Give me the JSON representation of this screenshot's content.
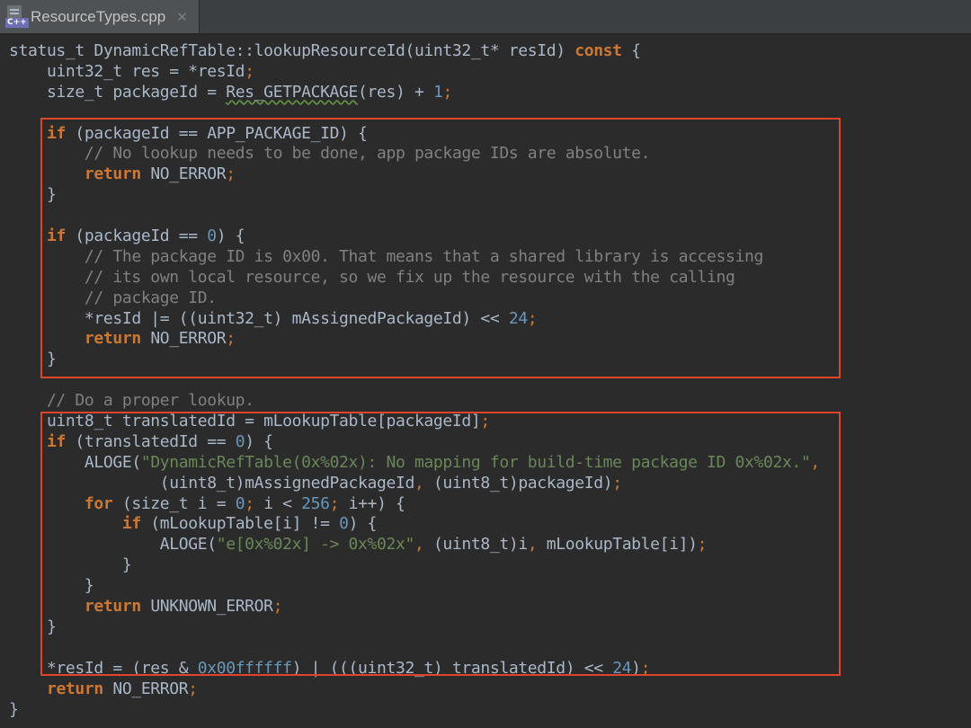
{
  "tab": {
    "title": "ResourceTypes.cpp",
    "icon_badge": "C++",
    "close_glyph": "✕"
  },
  "colors": {
    "keyword": "#cc7832",
    "number": "#6897bb",
    "string": "#6a8759",
    "comment": "#808080",
    "text": "#a9b7c6",
    "highlight_box": "#e0442d",
    "background": "#2b2b2b"
  },
  "code_lines": [
    [
      [
        "t",
        "status_t DynamicRefTable::lookupResourceId(uint32_t* resId) "
      ],
      [
        "kw",
        "const"
      ],
      [
        "t",
        " {"
      ]
    ],
    [
      [
        "t",
        "    uint32_t res = *resId"
      ],
      [
        "pun",
        ";"
      ]
    ],
    [
      [
        "t",
        "    size_t packageId = "
      ],
      [
        "mac",
        "Res_GETPACKAGE"
      ],
      [
        "t",
        "(res) + "
      ],
      [
        "num",
        "1"
      ],
      [
        "pun",
        ";"
      ]
    ],
    [
      [
        "t",
        ""
      ]
    ],
    [
      [
        "t",
        "    "
      ],
      [
        "kw",
        "if"
      ],
      [
        "t",
        " (packageId == APP_PACKAGE_ID) {"
      ]
    ],
    [
      [
        "cm",
        "        // No lookup needs to be done, app package IDs are absolute."
      ]
    ],
    [
      [
        "t",
        "        "
      ],
      [
        "kw",
        "return"
      ],
      [
        "t",
        " NO_ERROR"
      ],
      [
        "pun",
        ";"
      ]
    ],
    [
      [
        "t",
        "    }"
      ]
    ],
    [
      [
        "t",
        ""
      ]
    ],
    [
      [
        "t",
        "    "
      ],
      [
        "kw",
        "if"
      ],
      [
        "t",
        " (packageId == "
      ],
      [
        "num",
        "0"
      ],
      [
        "t",
        ") {"
      ]
    ],
    [
      [
        "cm",
        "        // The package ID is 0x00. That means that a shared library is accessing"
      ]
    ],
    [
      [
        "cm",
        "        // its own local resource, so we fix up the resource with the calling"
      ]
    ],
    [
      [
        "cm",
        "        // package ID."
      ]
    ],
    [
      [
        "t",
        "        *resId |= ((uint32_t) mAssignedPackageId) << "
      ],
      [
        "num",
        "24"
      ],
      [
        "pun",
        ";"
      ]
    ],
    [
      [
        "t",
        "        "
      ],
      [
        "kw",
        "return"
      ],
      [
        "t",
        " NO_ERROR"
      ],
      [
        "pun",
        ";"
      ]
    ],
    [
      [
        "t",
        "    }"
      ]
    ],
    [
      [
        "t",
        ""
      ]
    ],
    [
      [
        "cm",
        "    // Do a proper lookup."
      ]
    ],
    [
      [
        "t",
        "    uint8_t translatedId = mLookupTable[packageId]"
      ],
      [
        "pun",
        ";"
      ]
    ],
    [
      [
        "t",
        "    "
      ],
      [
        "kw",
        "if"
      ],
      [
        "t",
        " (translatedId == "
      ],
      [
        "num",
        "0"
      ],
      [
        "t",
        ") {"
      ]
    ],
    [
      [
        "t",
        "        ALOGE("
      ],
      [
        "str",
        "\"DynamicRefTable(0x%02x): No mapping for build-time package ID 0x%02x.\""
      ],
      [
        "pun",
        ","
      ]
    ],
    [
      [
        "t",
        "                (uint8_t)mAssignedPackageId"
      ],
      [
        "pun",
        ","
      ],
      [
        "t",
        " (uint8_t)packageId)"
      ],
      [
        "pun",
        ";"
      ]
    ],
    [
      [
        "t",
        "        "
      ],
      [
        "kw",
        "for"
      ],
      [
        "t",
        " (size_t i = "
      ],
      [
        "num",
        "0"
      ],
      [
        "pun",
        ";"
      ],
      [
        "t",
        " i < "
      ],
      [
        "num",
        "256"
      ],
      [
        "pun",
        ";"
      ],
      [
        "t",
        " i++) {"
      ]
    ],
    [
      [
        "t",
        "            "
      ],
      [
        "kw",
        "if"
      ],
      [
        "t",
        " (mLookupTable[i] != "
      ],
      [
        "num",
        "0"
      ],
      [
        "t",
        ") {"
      ]
    ],
    [
      [
        "t",
        "                ALOGE("
      ],
      [
        "str",
        "\"e[0x%02x] -> 0x%02x\""
      ],
      [
        "pun",
        ","
      ],
      [
        "t",
        " (uint8_t)i"
      ],
      [
        "pun",
        ","
      ],
      [
        "t",
        " mLookupTable[i])"
      ],
      [
        "pun",
        ";"
      ]
    ],
    [
      [
        "t",
        "            }"
      ]
    ],
    [
      [
        "t",
        "        }"
      ]
    ],
    [
      [
        "t",
        "        "
      ],
      [
        "kw",
        "return"
      ],
      [
        "t",
        " UNKNOWN_ERROR"
      ],
      [
        "pun",
        ";"
      ]
    ],
    [
      [
        "t",
        "    }"
      ]
    ],
    [
      [
        "t",
        ""
      ]
    ],
    [
      [
        "t",
        "    *resId = (res & "
      ],
      [
        "num",
        "0x00ffffff"
      ],
      [
        "t",
        ") | (((uint32_t) translatedId) << "
      ],
      [
        "num",
        "24"
      ],
      [
        "t",
        ")"
      ],
      [
        "pun",
        ";"
      ]
    ],
    [
      [
        "t",
        "    "
      ],
      [
        "kw",
        "return"
      ],
      [
        "t",
        " NO_ERROR"
      ],
      [
        "pun",
        ";"
      ]
    ],
    [
      [
        "t",
        "}"
      ]
    ]
  ]
}
